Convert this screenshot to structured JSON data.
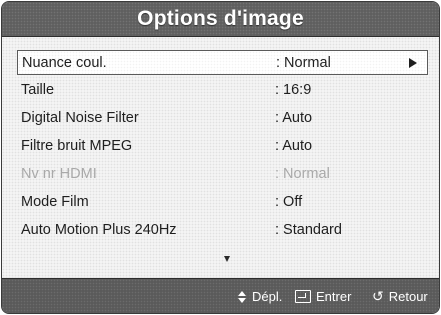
{
  "window": {
    "title": "Options d'image"
  },
  "menu": {
    "items": [
      {
        "label": "Nuance coul.",
        "value": ": Normal",
        "selected": true,
        "enabled": true,
        "has_submenu": true
      },
      {
        "label": "Taille",
        "value": ": 16:9",
        "selected": false,
        "enabled": true
      },
      {
        "label": "Digital Noise Filter",
        "value": ": Auto",
        "selected": false,
        "enabled": true
      },
      {
        "label": "Filtre bruit MPEG",
        "value": ": Auto",
        "selected": false,
        "enabled": true
      },
      {
        "label": "Nv nr HDMI",
        "value": ": Normal",
        "selected": false,
        "enabled": false
      },
      {
        "label": "Mode Film",
        "value": ": Off",
        "selected": false,
        "enabled": true
      },
      {
        "label": "Auto Motion Plus 240Hz",
        "value": ": Standard",
        "selected": false,
        "enabled": true
      }
    ],
    "more_indicator_icon": "down-triangle-icon"
  },
  "footer": {
    "hints": [
      {
        "icon": "up-down-arrows-icon",
        "label": "Dépl."
      },
      {
        "icon": "enter-icon",
        "label": "Entrer"
      },
      {
        "icon": "return-icon",
        "label": "Retour"
      }
    ]
  },
  "colors": {
    "header_bg": "#5f5f5f",
    "footer_bg": "#5a5a5a",
    "content_bg": "#f4f4f4",
    "text": "#1e1e1e",
    "disabled_text": "#a9a9a9",
    "selection_border": "#5a5a5a"
  }
}
